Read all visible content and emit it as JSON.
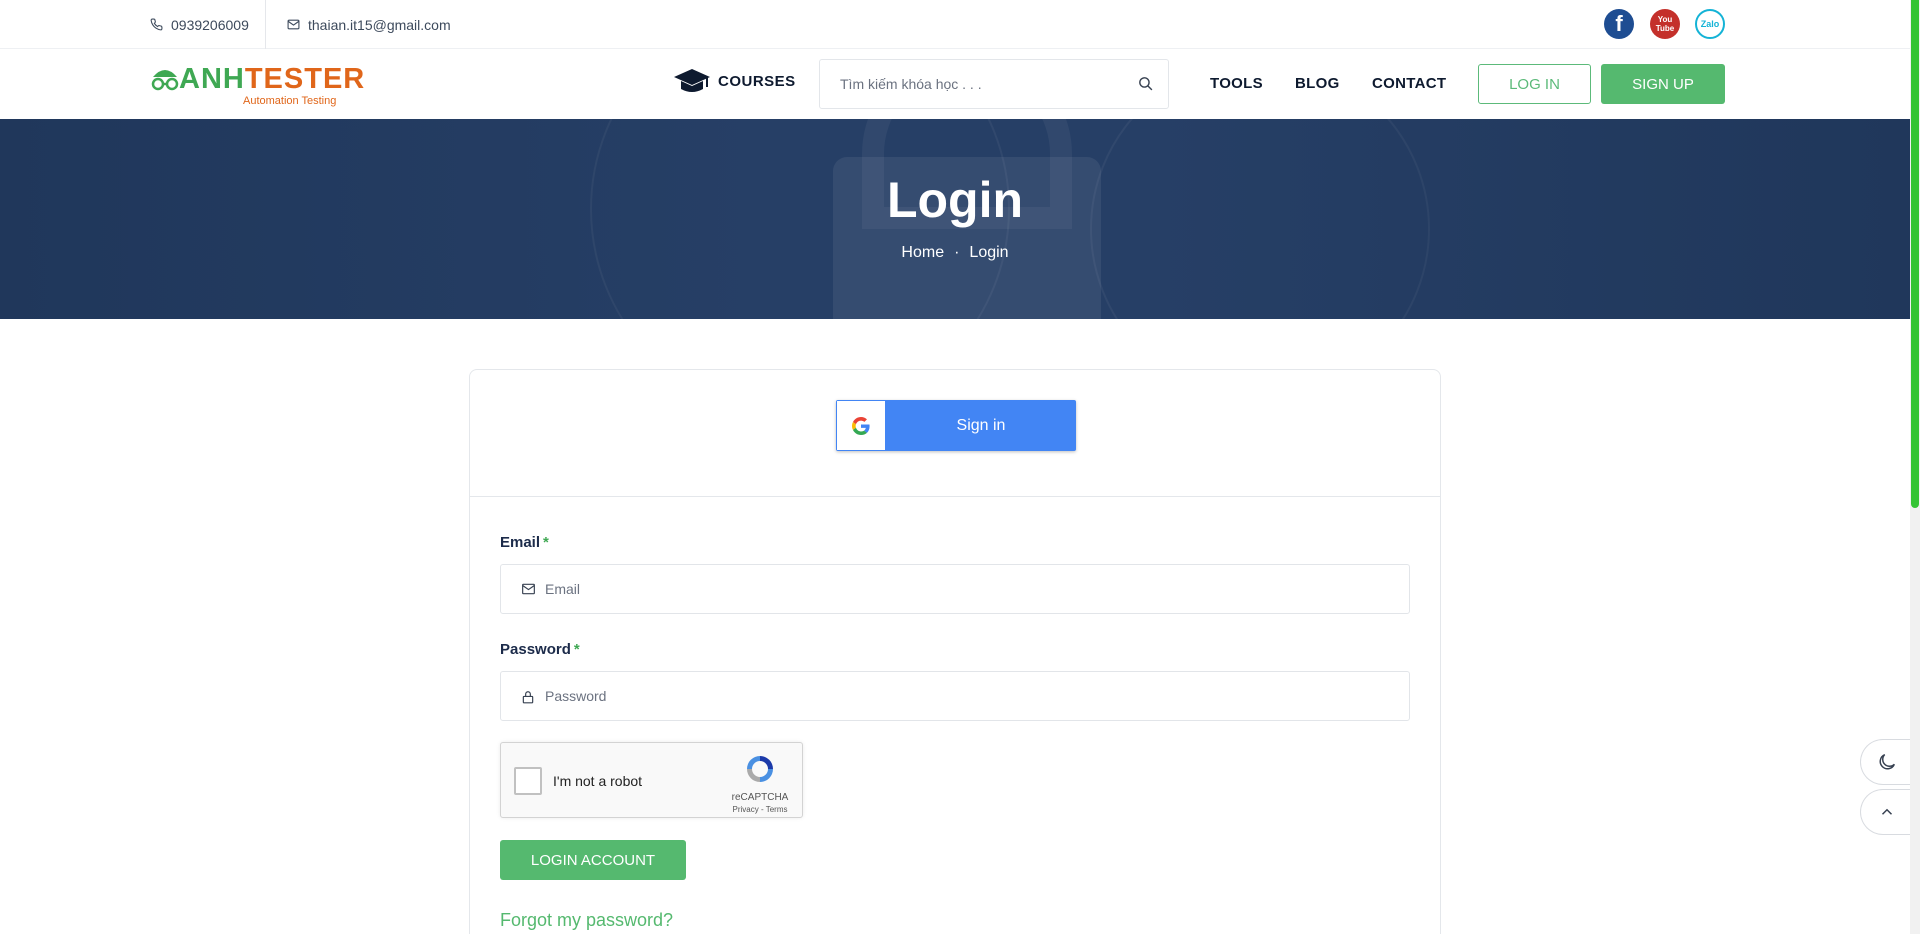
{
  "topbar": {
    "phone": "0939206009",
    "email": "thaian.it15@gmail.com",
    "social": {
      "facebook": "f",
      "youtube_top": "You",
      "youtube_bottom": "Tube",
      "zalo": "Zalo"
    }
  },
  "header": {
    "logo_word_a": "ANH",
    "logo_word_b": "TESTER",
    "logo_tagline": "Automation Testing",
    "courses_label": "COURSES",
    "search_placeholder": "Tìm kiếm khóa học . . .",
    "nav": {
      "tools": "TOOLS",
      "blog": "BLOG",
      "contact": "CONTACT"
    },
    "login_label": "LOG IN",
    "signup_label": "SIGN UP"
  },
  "banner": {
    "title": "Login",
    "breadcrumb": {
      "home": "Home",
      "separator": "·",
      "current": "Login"
    }
  },
  "login_form": {
    "google_button": "Sign in",
    "email_label": "Email",
    "email_required": "*",
    "email_placeholder": "Email",
    "password_label": "Password",
    "password_required": "*",
    "password_placeholder": "Password",
    "captcha": {
      "text": "I'm not a robot",
      "brand": "reCAPTCHA",
      "links": "Privacy - Terms"
    },
    "submit_label": "LOGIN ACCOUNT",
    "forgot_label": "Forgot my password?"
  },
  "icons": {
    "phone": "phone-icon",
    "mail": "mail-icon",
    "graduation": "graduation-cap-icon",
    "search": "search-icon",
    "lock": "lock-icon",
    "moon": "moon-icon",
    "chevron_up": "chevron-up-icon",
    "google": "google-icon"
  },
  "colors": {
    "brand_green": "#55b96f",
    "brand_orange": "#e0661a",
    "banner": "#263f66",
    "google_blue": "#4285f4",
    "scrollbar": "#34c434"
  }
}
